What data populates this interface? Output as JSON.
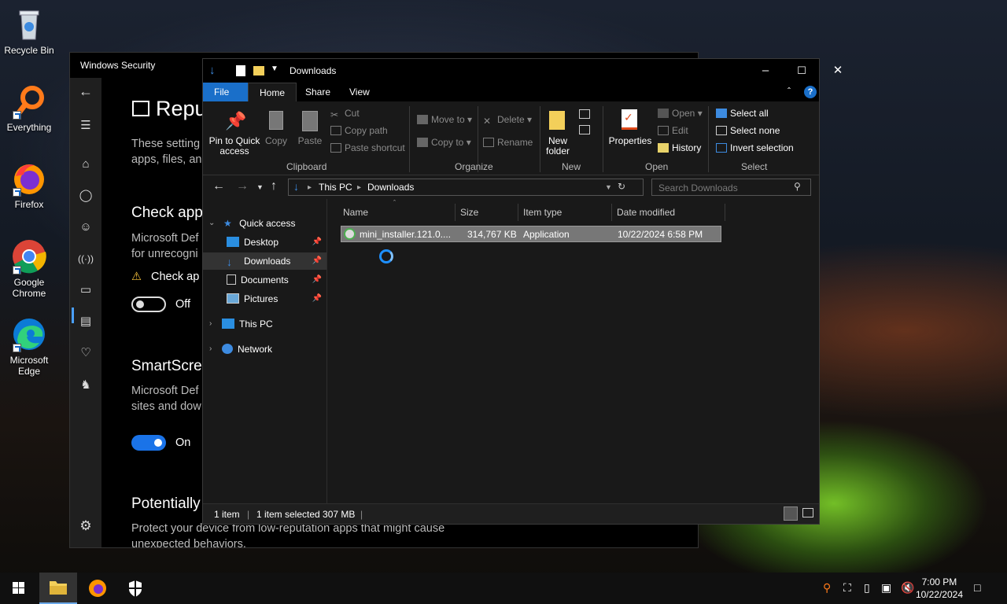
{
  "desktop": {
    "icons": [
      {
        "label": "Recycle Bin"
      },
      {
        "label": "Everything"
      },
      {
        "label": "Firefox"
      },
      {
        "label": "Google Chrome"
      },
      {
        "label": "Microsoft Edge"
      }
    ]
  },
  "winsec": {
    "title": "Windows Security",
    "heading": "Repu",
    "intro_1": "These setting",
    "intro_2": "apps, files, and",
    "check_apps": {
      "title": "Check app",
      "desc_1": "Microsoft Def",
      "desc_2": "for unrecogni",
      "warning": "Check ap",
      "toggle_label": "Off"
    },
    "smartscreen": {
      "title": "SmartScre",
      "desc_1": "Microsoft Def",
      "desc_2": "sites and dow",
      "toggle_label": "On"
    },
    "potentially": {
      "title": "Potentially",
      "desc_1": "Protect your device from low-reputation apps that might cause",
      "desc_2": "unexpected behaviors."
    }
  },
  "explorer": {
    "title": "Downloads",
    "tabs": {
      "file": "File",
      "home": "Home",
      "share": "Share",
      "view": "View"
    },
    "ribbon": {
      "pin_to_quick_access": "Pin to Quick access",
      "copy": "Copy",
      "paste": "Paste",
      "cut": "Cut",
      "copy_path": "Copy path",
      "paste_shortcut": "Paste shortcut",
      "clipboard": "Clipboard",
      "move_to": "Move to",
      "copy_to": "Copy to",
      "delete": "Delete",
      "rename": "Rename",
      "organize": "Organize",
      "new_folder": "New folder",
      "new": "New",
      "properties": "Properties",
      "open": "Open",
      "edit": "Edit",
      "history": "History",
      "open_group": "Open",
      "select_all": "Select all",
      "select_none": "Select none",
      "invert_selection": "Invert selection",
      "select_group": "Select"
    },
    "address": {
      "crumb_1": "This PC",
      "crumb_2": "Downloads"
    },
    "search_placeholder": "Search Downloads",
    "tree": {
      "quick_access": "Quick access",
      "desktop": "Desktop",
      "downloads": "Downloads",
      "documents": "Documents",
      "pictures": "Pictures",
      "this_pc": "This PC",
      "network": "Network"
    },
    "columns": {
      "name": "Name",
      "size": "Size",
      "type": "Item type",
      "date": "Date modified"
    },
    "files": [
      {
        "name": "mini_installer.121.0....",
        "size": "314,767 KB",
        "type": "Application",
        "date": "10/22/2024 6:58 PM"
      }
    ],
    "status": {
      "count": "1 item",
      "selected": "1 item selected  307 MB"
    }
  },
  "taskbar": {
    "time": "7:00 PM",
    "date": "10/22/2024"
  },
  "colors": {
    "accent": "#1a73e8",
    "file_tab": "#1a6fc9"
  }
}
